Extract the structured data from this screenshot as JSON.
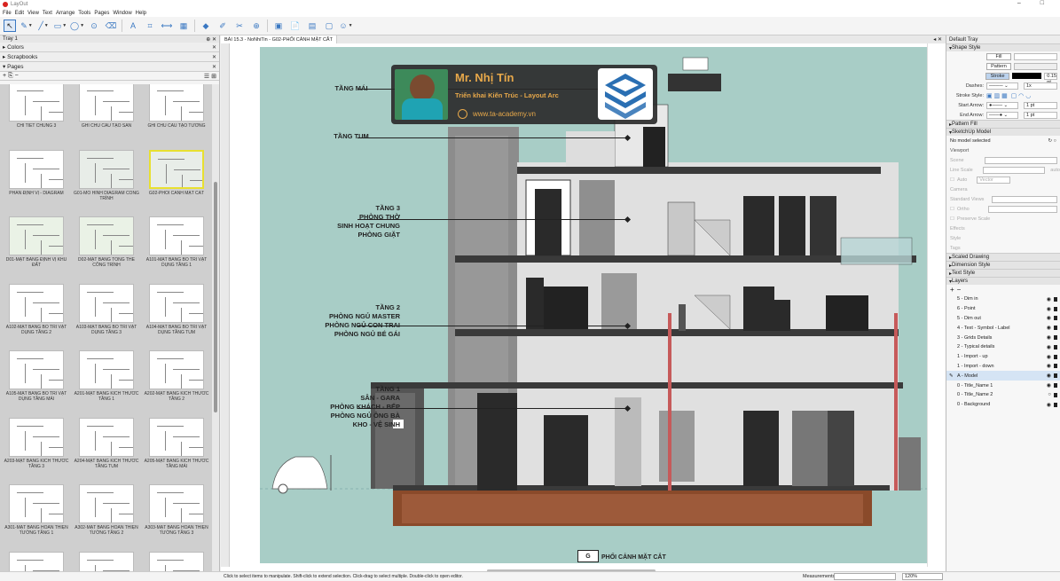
{
  "app": {
    "title": "LayOut",
    "window_controls": "– □"
  },
  "menu": [
    "File",
    "Edit",
    "View",
    "Text",
    "Arrange",
    "Tools",
    "Pages",
    "Window",
    "Help"
  ],
  "toolbar_icons": [
    "select-arrow-icon",
    "pencil-icon",
    "line-icon",
    "rectangle-icon",
    "circle-icon",
    "offset-icon",
    "eraser-icon",
    "text-icon",
    "label-icon",
    "dimension-icon",
    "table-icon",
    "paint-bucket-icon",
    "eyedropper-icon",
    "split-icon",
    "join-icon",
    "insert-icon",
    "add-page-icon",
    "document-icon",
    "presentation-icon",
    "share-icon"
  ],
  "left_tray": {
    "tray_title": "Tray 1",
    "sections": [
      "Colors",
      "Scrapbooks",
      "Pages"
    ],
    "pages": [
      {
        "label": "CHI TIẾT CHUNG 3"
      },
      {
        "label": "GHI CHÚ CẤU TẠO SÀN"
      },
      {
        "label": "GHI CHÚ CẤU TẠO TƯỜNG"
      },
      {
        "label": "PHÂN ĐỊNH VỊ - DIAGRAM"
      },
      {
        "label": "G01-MÔ HÌNH DIAGRAM CÔNG TRÌNH"
      },
      {
        "label": "G02-PHỐI CẢNH MẶT CẮT",
        "selected": true
      },
      {
        "label": "D01-MẶT BẰNG ĐỊNH VỊ KHU ĐẤT"
      },
      {
        "label": "D02-MẶT BẰNG TỔNG THỂ CÔNG TRÌNH"
      },
      {
        "label": "A101-MẶT BẰNG BỐ TRÍ VẬT DỤNG TẦNG 1"
      },
      {
        "label": "A102-MẶT BẰNG BỐ TRÍ VẬT DỤNG TẦNG 2"
      },
      {
        "label": "A103-MẶT BẰNG BỐ TRÍ VẬT DỤNG TẦNG 3"
      },
      {
        "label": "A104-MẶT BẰNG BỐ TRÍ VẬT DỤNG TẦNG TUM"
      },
      {
        "label": "A105-MẶT BẰNG BỐ TRÍ VẬT DỤNG TẦNG MÁI"
      },
      {
        "label": "A201-MẶT BẰNG KÍCH THƯỚC TẦNG 1"
      },
      {
        "label": "A202-MẶT BẰNG KÍCH THƯỚC TẦNG 2"
      },
      {
        "label": "A203-MẶT BẰNG KÍCH THƯỚC TẦNG 3"
      },
      {
        "label": "A204-MẶT BẰNG KÍCH THƯỚC TẦNG TUM"
      },
      {
        "label": "A205-MẶT BẰNG KÍCH THƯỚC TẦNG MÁI"
      },
      {
        "label": "A301-MẶT BẰNG HOÀN THIỆN TƯỜNG TẦNG 1"
      },
      {
        "label": "A302-MẶT BẰNG HOÀN THIỆN TƯỜNG TẦNG 2"
      },
      {
        "label": "A303-MẶT BẰNG HOÀN THIỆN TƯỜNG TẦNG 3"
      },
      {
        "label": ""
      },
      {
        "label": ""
      },
      {
        "label": ""
      }
    ]
  },
  "document_tab": "BÀI 15.3 - NoNhiTin - G02-PHỐI CẢNH MẶT CẮT",
  "drawing": {
    "annotations": [
      {
        "text": "TẦNG MÁI"
      },
      {
        "text": "TẦNG TUM"
      },
      {
        "text": "TẦNG 3\nPHÒNG THỜ\nSINH HOẠT CHUNG\nPHÒNG GIẶT"
      },
      {
        "text": "TẦNG 2\nPHÒNG NGỦ MASTER\nPHÒNG NGỦ CON TRAI\nPHÒNG NGỦ BÉ GÁI"
      },
      {
        "text": "TẦNG 1\nSÂN - GARA\nPHÒNG KHÁCH - BẾP\nPHÒNG NGỦ ÔNG BÀ\nKHO - VỆ SINH"
      }
    ],
    "title_block_letter": "G",
    "title": "PHỐI CẢNH MẶT CẮT"
  },
  "banner": {
    "name": "Mr. Nhị Tín",
    "subtitle": "Triển khai Kiến Trúc - Layout Arc",
    "website": "www.ta-academy.vn"
  },
  "right_tray": {
    "title": "Default Tray",
    "shape_style": {
      "header": "Shape Style",
      "fill": "Fill",
      "pattern": "Pattern",
      "stroke": "Stroke",
      "stroke_weight": "0.15 pt",
      "dashes_label": "Dashes:",
      "dashes_value": "1x",
      "stroke_style_label": "Stroke Style:",
      "start_arrow_label": "Start Arrow:",
      "start_arrow_value": "1 pt",
      "end_arrow_label": "End Arrow:",
      "end_arrow_value": "1 pt"
    },
    "pattern_fill": "Pattern Fill",
    "sketchup_model": {
      "header": "SketchUp Model",
      "status": "No model selected",
      "viewport": "Viewport",
      "scene": "Scene",
      "line_scale": "Line Scale",
      "line_scale_value": "auto",
      "auto": "Auto",
      "vector": "Vector",
      "camera": "Camera",
      "standard_views": "Standard Views",
      "ortho": "Ortho",
      "preserve_scale": "Preserve Scale",
      "effects": "Effects",
      "style": "Style",
      "tags": "Tags"
    },
    "collapsed": [
      "Scaled Drawing",
      "Dimension Style",
      "Text Style"
    ],
    "layers_header": "Layers",
    "layers": [
      {
        "name": "5 - Dim in"
      },
      {
        "name": "6 - Point"
      },
      {
        "name": "5 - Dim out"
      },
      {
        "name": "4 - Text - Symbol - Label"
      },
      {
        "name": "3 - Grids Details"
      },
      {
        "name": "2 - Typical details"
      },
      {
        "name": "1 - Import - up"
      },
      {
        "name": "1 - Import - down"
      },
      {
        "name": "A - Model",
        "active": true
      },
      {
        "name": "0 - Title_Name 1"
      },
      {
        "name": "0 - Title_Name 2"
      },
      {
        "name": "0 - Background"
      }
    ]
  },
  "status": {
    "hint": "Click to select items to manipulate. Shift-click to extend selection. Click-drag to select multiple. Double-click to open editor.",
    "measurements_label": "Measurements",
    "zoom": "120%"
  }
}
